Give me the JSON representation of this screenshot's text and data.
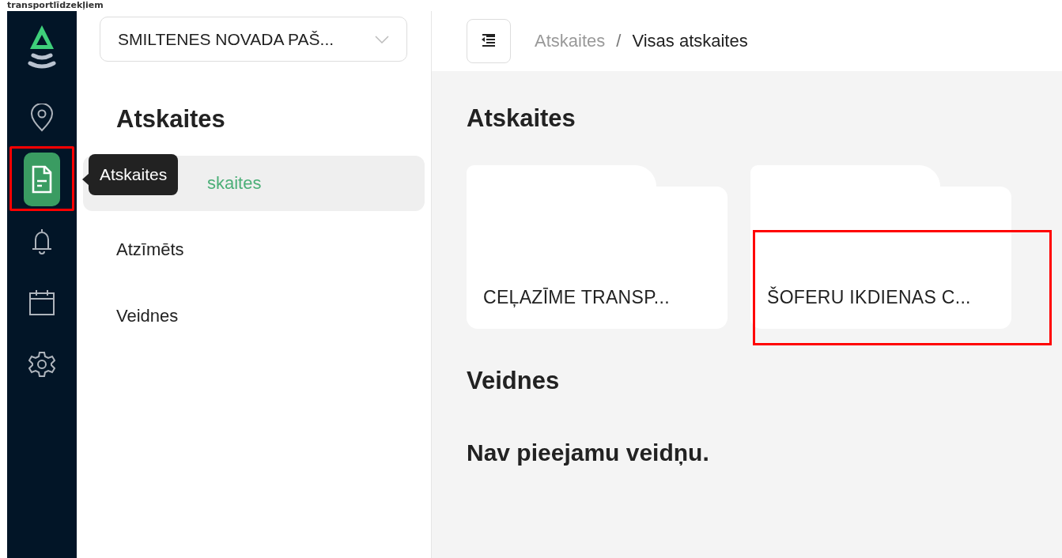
{
  "top_caption": "transportlīdzekļiem",
  "rail": {
    "items": [
      {
        "kind": "pin",
        "selected": false,
        "highlighted": false
      },
      {
        "kind": "report",
        "selected": true,
        "highlighted": true
      },
      {
        "kind": "bell",
        "selected": false,
        "highlighted": false
      },
      {
        "kind": "calendar",
        "selected": false,
        "highlighted": false
      },
      {
        "kind": "gear",
        "selected": false,
        "highlighted": false
      }
    ],
    "tooltip": "Atskaites"
  },
  "sidebar": {
    "organization": "SMILTENES NOVADA PAŠ...",
    "title": "Atskaites",
    "items": [
      {
        "label": "skaites",
        "selected": true,
        "covered": true
      },
      {
        "label": "Atzīmēts",
        "selected": false,
        "covered": false
      },
      {
        "label": "Veidnes",
        "selected": false,
        "covered": false
      }
    ]
  },
  "breadcrumb": [
    {
      "label": "Atskaites",
      "current": false
    },
    {
      "label": "Visas atskaites",
      "current": true
    }
  ],
  "breadcrumb_separator": "/",
  "main": {
    "title": "Atskaites",
    "folders": [
      {
        "label": "CEĻAZĪME TRANSP...",
        "highlighted": false
      },
      {
        "label": "ŠOFERU IKDIENAS C...",
        "highlighted": true
      }
    ],
    "templates_title": "Veidnes",
    "templates_empty": "Nav pieejamu veidņu."
  }
}
